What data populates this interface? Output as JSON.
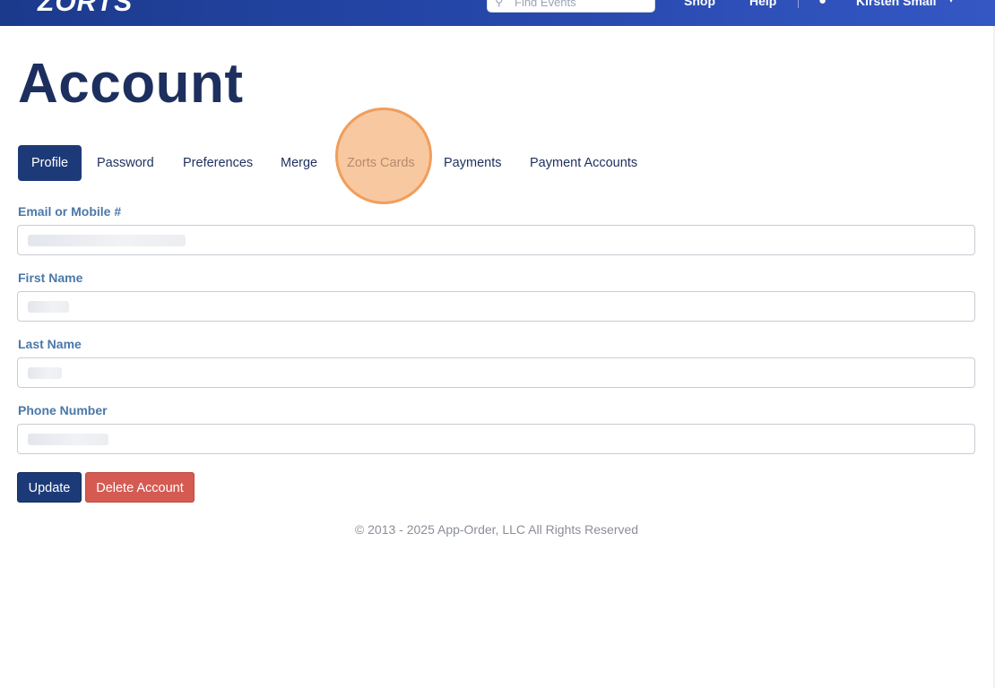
{
  "header": {
    "logo": "ZORTS",
    "search_placeholder": "Find Events",
    "nav_links": [
      "Shop",
      "Help"
    ],
    "user_name": "Kirsten Small",
    "colors": {
      "bar": "#2446a8"
    }
  },
  "page": {
    "title": "Account"
  },
  "tabs": [
    {
      "label": "Profile",
      "active": true
    },
    {
      "label": "Password"
    },
    {
      "label": "Preferences"
    },
    {
      "label": "Merge"
    },
    {
      "label": "Zorts Cards"
    },
    {
      "label": "Payments"
    },
    {
      "label": "Payment Accounts"
    }
  ],
  "form": {
    "fields": [
      {
        "label": "Email or Mobile #",
        "value": ""
      },
      {
        "label": "First Name",
        "value": ""
      },
      {
        "label": "Last Name",
        "value": ""
      },
      {
        "label": "Phone Number",
        "value": ""
      }
    ],
    "update_label": "Update",
    "delete_label": "Delete Account"
  },
  "footer": {
    "text": "© 2013 - 2025 App-Order, LLC All Rights Reserved"
  },
  "colors": {
    "primary": "#1d3a78",
    "danger": "#d45a52",
    "label": "#4a78a8",
    "click_highlight": "#f29a52"
  }
}
